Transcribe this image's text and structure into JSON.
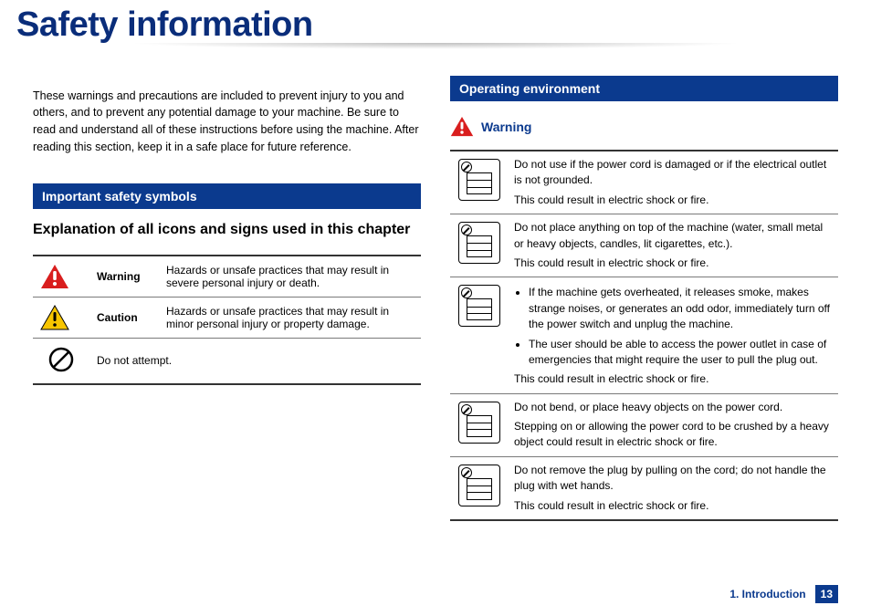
{
  "page": {
    "title": "Safety information",
    "intro": "These warnings and precautions are included to prevent injury to you and others, and to prevent any potential damage to your machine. Be sure to read and understand all of these instructions before using the machine. After reading this section, keep it in a safe place for future reference."
  },
  "colors": {
    "accent": "#0b3a8e",
    "warning": "#d91e1e",
    "caution": "#f7c500"
  },
  "sections": {
    "symbols_heading": "Important safety symbols",
    "symbols_sub": "Explanation of all icons and signs used in this chapter",
    "operating_env": "Operating environment",
    "warning_label": "Warning"
  },
  "symbol_table": [
    {
      "icon": "warning-triangle-red",
      "term": "Warning",
      "desc": "Hazards or unsafe practices that may result in severe personal injury or death."
    },
    {
      "icon": "caution-triangle-yellow",
      "term": "Caution",
      "desc": "Hazards or unsafe practices that may result in minor personal injury or property damage."
    },
    {
      "icon": "prohibit-circle",
      "term": "",
      "desc": "Do not attempt."
    }
  ],
  "warnings": [
    {
      "icon": "damaged-cord-icon",
      "lines": [
        "Do not use if the power cord is damaged or if the electrical outlet is not grounded.",
        "This could result in electric shock or fire."
      ]
    },
    {
      "icon": "objects-on-machine-icon",
      "lines": [
        "Do not place anything on top of the machine (water, small metal or heavy objects, candles, lit cigarettes, etc.).",
        "This could result in electric shock or fire."
      ]
    },
    {
      "icon": "overheat-unplug-icon",
      "bullets": [
        "If the machine gets overheated, it releases smoke, makes strange noises, or generates an odd odor, immediately turn off the power switch and unplug the machine.",
        "The user should be able to access the power outlet in case of emergencies that might require the user to pull the plug out."
      ],
      "tail": "This could result in electric shock or fire."
    },
    {
      "icon": "cord-bend-icon",
      "lines": [
        "Do not bend, or place heavy objects on the power cord.",
        "Stepping on or allowing the power cord to be crushed by a heavy object could result in electric shock or fire."
      ]
    },
    {
      "icon": "wet-hands-plug-icon",
      "lines": [
        "Do not remove the plug by pulling on the cord; do not handle the plug with wet hands.",
        "This could result in electric shock or fire."
      ]
    }
  ],
  "footer": {
    "chapter": "1. Introduction",
    "page": "13"
  }
}
